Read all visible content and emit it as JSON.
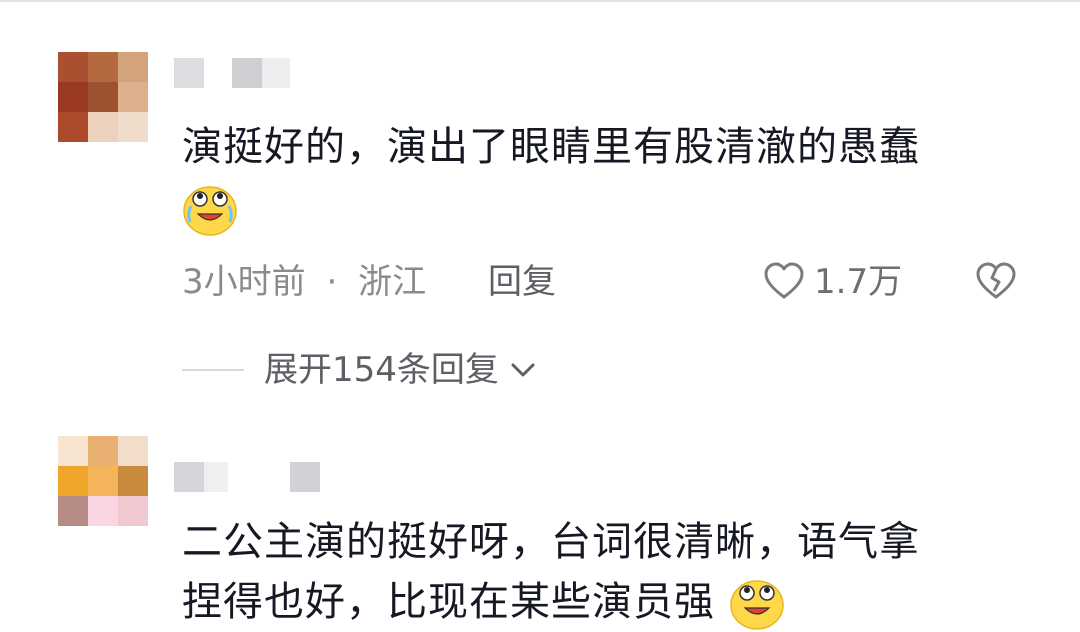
{
  "comments": [
    {
      "text_lines": [
        "演挺好的，演出了眼睛里有股清澈的愚蠢"
      ],
      "emoji": "crying-laughing-face-icon",
      "time": "3小时前",
      "separator": "·",
      "location": "浙江",
      "reply_label": "回复",
      "like_count": "1.7万",
      "expand_label": "展开154条回复"
    },
    {
      "text_lines": [
        "二公主演的挺好呀，台词很清晰，语气拿",
        "捏得也好，比现在某些演员强"
      ],
      "emoji": "crying-laughing-face-icon"
    }
  ],
  "colors": {
    "text_primary": "#161823",
    "text_secondary": "#8a8a8f",
    "icon_gray": "#7a7a80"
  }
}
